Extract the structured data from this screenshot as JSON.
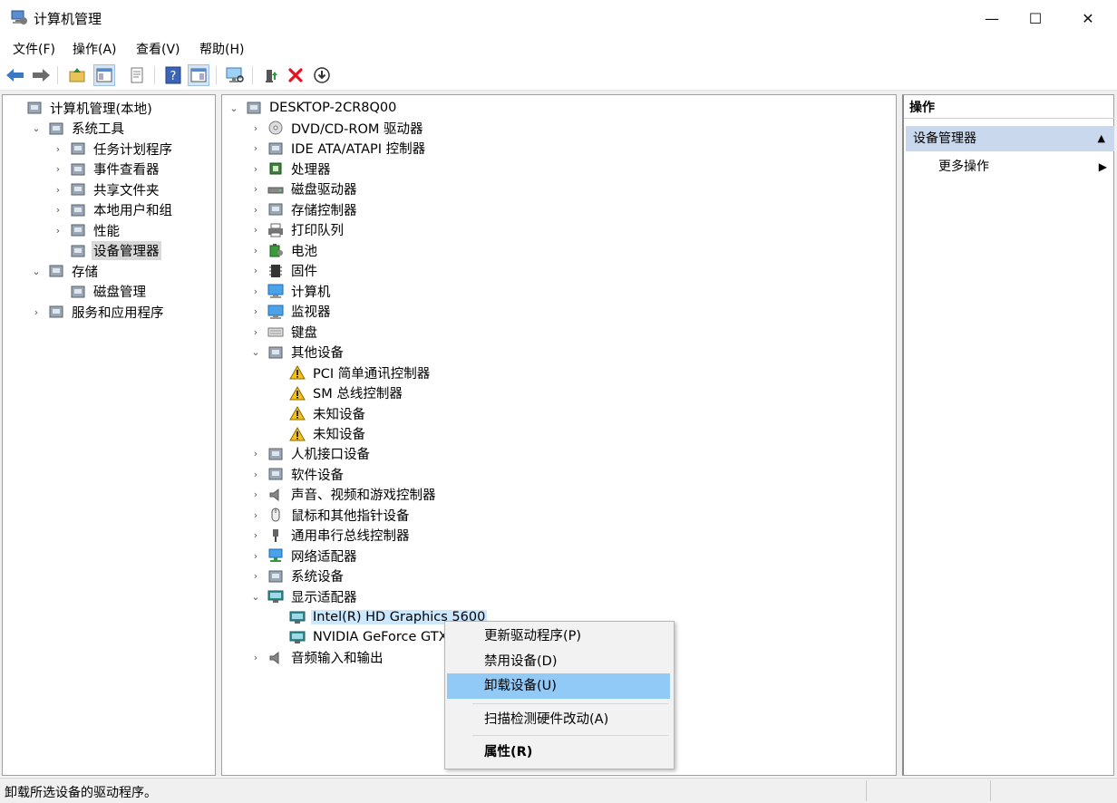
{
  "window": {
    "title": "计算机管理",
    "minimize": "—",
    "maximize": "☐",
    "close": "✕"
  },
  "menu": [
    "文件(F)",
    "操作(A)",
    "查看(V)",
    "帮助(H)"
  ],
  "colors": {
    "selection_blue": "#cce8ff",
    "menu_highlight": "#91c9f7",
    "action_header": "#c9d8ec",
    "delete_red": "#e81123"
  },
  "left_tree": [
    {
      "label": "计算机管理(本地)",
      "depth": 0,
      "expander": "",
      "icon": "computer-management-icon"
    },
    {
      "label": "系统工具",
      "depth": 1,
      "expander": "⌄",
      "icon": "tools-icon"
    },
    {
      "label": "任务计划程序",
      "depth": 2,
      "expander": "›",
      "icon": "clock-icon"
    },
    {
      "label": "事件查看器",
      "depth": 2,
      "expander": "›",
      "icon": "event-viewer-icon"
    },
    {
      "label": "共享文件夹",
      "depth": 2,
      "expander": "›",
      "icon": "shared-folder-icon"
    },
    {
      "label": "本地用户和组",
      "depth": 2,
      "expander": "›",
      "icon": "users-icon"
    },
    {
      "label": "性能",
      "depth": 2,
      "expander": "›",
      "icon": "performance-icon"
    },
    {
      "label": "设备管理器",
      "depth": 2,
      "expander": "",
      "icon": "device-manager-icon",
      "selected": true
    },
    {
      "label": "存储",
      "depth": 1,
      "expander": "⌄",
      "icon": "storage-icon"
    },
    {
      "label": "磁盘管理",
      "depth": 2,
      "expander": "",
      "icon": "disk-management-icon"
    },
    {
      "label": "服务和应用程序",
      "depth": 1,
      "expander": "›",
      "icon": "services-icon"
    }
  ],
  "device_tree": [
    {
      "label": "DESKTOP-2CR8Q00",
      "depth": 0,
      "expander": "⌄",
      "icon": "computer-root-icon"
    },
    {
      "label": "DVD/CD-ROM 驱动器",
      "depth": 1,
      "expander": "›",
      "icon": "dvd-icon"
    },
    {
      "label": "IDE ATA/ATAPI 控制器",
      "depth": 1,
      "expander": "›",
      "icon": "ide-icon"
    },
    {
      "label": "处理器",
      "depth": 1,
      "expander": "›",
      "icon": "processor-icon"
    },
    {
      "label": "磁盘驱动器",
      "depth": 1,
      "expander": "›",
      "icon": "disk-drive-icon"
    },
    {
      "label": "存储控制器",
      "depth": 1,
      "expander": "›",
      "icon": "storage-controller-icon"
    },
    {
      "label": "打印队列",
      "depth": 1,
      "expander": "›",
      "icon": "printer-icon"
    },
    {
      "label": "电池",
      "depth": 1,
      "expander": "›",
      "icon": "battery-icon"
    },
    {
      "label": "固件",
      "depth": 1,
      "expander": "›",
      "icon": "firmware-icon"
    },
    {
      "label": "计算机",
      "depth": 1,
      "expander": "›",
      "icon": "computer-icon"
    },
    {
      "label": "监视器",
      "depth": 1,
      "expander": "›",
      "icon": "monitor-icon"
    },
    {
      "label": "键盘",
      "depth": 1,
      "expander": "›",
      "icon": "keyboard-icon"
    },
    {
      "label": "其他设备",
      "depth": 1,
      "expander": "⌄",
      "icon": "other-devices-icon"
    },
    {
      "label": "PCI 简单通讯控制器",
      "depth": 2,
      "expander": "",
      "icon": "warning-device-icon"
    },
    {
      "label": "SM 总线控制器",
      "depth": 2,
      "expander": "",
      "icon": "warning-device-icon"
    },
    {
      "label": "未知设备",
      "depth": 2,
      "expander": "",
      "icon": "warning-device-icon"
    },
    {
      "label": "未知设备",
      "depth": 2,
      "expander": "",
      "icon": "warning-device-icon"
    },
    {
      "label": "人机接口设备",
      "depth": 1,
      "expander": "›",
      "icon": "hid-icon"
    },
    {
      "label": "软件设备",
      "depth": 1,
      "expander": "›",
      "icon": "software-device-icon"
    },
    {
      "label": "声音、视频和游戏控制器",
      "depth": 1,
      "expander": "›",
      "icon": "sound-icon"
    },
    {
      "label": "鼠标和其他指针设备",
      "depth": 1,
      "expander": "›",
      "icon": "mouse-icon"
    },
    {
      "label": "通用串行总线控制器",
      "depth": 1,
      "expander": "›",
      "icon": "usb-icon"
    },
    {
      "label": "网络适配器",
      "depth": 1,
      "expander": "›",
      "icon": "network-icon"
    },
    {
      "label": "系统设备",
      "depth": 1,
      "expander": "›",
      "icon": "system-device-icon"
    },
    {
      "label": "显示适配器",
      "depth": 1,
      "expander": "⌄",
      "icon": "display-adapter-icon"
    },
    {
      "label": "Intel(R) HD Graphics 5600",
      "depth": 2,
      "expander": "",
      "icon": "display-card-icon",
      "selected": true
    },
    {
      "label": "NVIDIA GeForce GTX",
      "depth": 2,
      "expander": "",
      "icon": "display-card-icon"
    },
    {
      "label": "音频输入和输出",
      "depth": 1,
      "expander": "›",
      "icon": "audio-io-icon"
    }
  ],
  "actions": {
    "header": "操作",
    "section": "设备管理器",
    "section_arrow": "▲",
    "more": "更多操作",
    "more_arrow": "▶"
  },
  "context_menu": {
    "update": "更新驱动程序(P)",
    "disable": "禁用设备(D)",
    "uninstall": "卸载设备(U)",
    "scan": "扫描检测硬件改动(A)",
    "properties": "属性(R)"
  },
  "status": "卸载所选设备的驱动程序。"
}
